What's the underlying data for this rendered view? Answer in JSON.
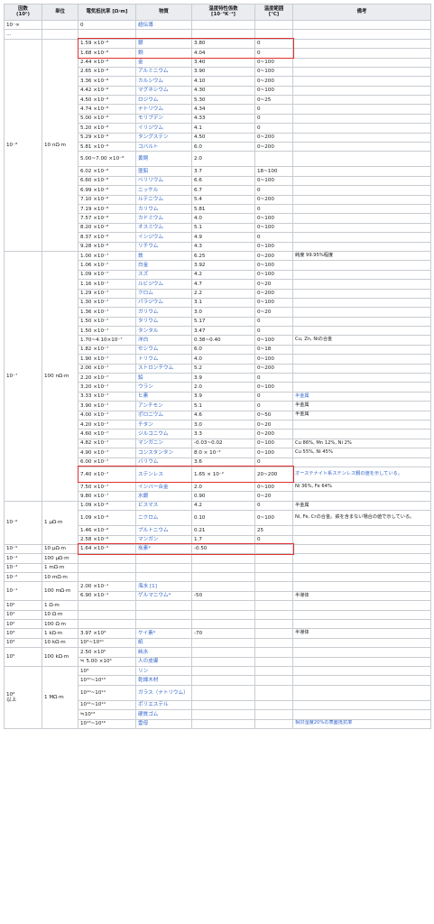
{
  "headers": {
    "factor": "因数\n(10ⁿ)",
    "unit": "単位",
    "resistivity": "電気抵抗率 [Ω·m]",
    "material": "物質",
    "tempcoef": "温度特性係数\n[10⁻³K⁻¹]",
    "temprange": "温度範囲\n[℃]",
    "note": "備考"
  },
  "top_rows": [
    {
      "factor": "10⁻∞",
      "resistivity": "0",
      "material": "超伝導",
      "link": true
    },
    {
      "factor": "…"
    }
  ],
  "groups": [
    {
      "factor": "10⁻⁸",
      "unit": "10 nΩ·m",
      "rows": [
        {
          "r": "1.59 ×10⁻⁸",
          "m": "銀",
          "c": "3.80",
          "t": "0",
          "hl": "silver"
        },
        {
          "r": "1.68 ×10⁻⁸",
          "m": "銅",
          "c": "4.04",
          "t": "0",
          "hl": "copper"
        },
        {
          "r": "2.44 ×10⁻⁸",
          "m": "金",
          "c": "3.40",
          "t": "0~100"
        },
        {
          "r": "2.65 ×10⁻⁸",
          "m": "アルミニウム",
          "c": "3.90",
          "t": "0~100"
        },
        {
          "r": "3.36 ×10⁻⁸",
          "m": "カルシウム",
          "c": "4.10",
          "t": "0~200"
        },
        {
          "r": "4.42 ×10⁻⁸",
          "m": "マグネシウム",
          "c": "4.30",
          "t": "0~100"
        },
        {
          "r": "4.50 ×10⁻⁸",
          "m": "ロジウム",
          "c": "5.30",
          "t": "0~25"
        },
        {
          "r": "4.74 ×10⁻⁸",
          "m": "ナトリウム",
          "c": "4.34",
          "t": "0"
        },
        {
          "r": "5.00 ×10⁻⁸",
          "m": "モリブデン",
          "c": "4.33",
          "t": "0"
        },
        {
          "r": "5.20 ×10⁻⁸",
          "m": "イリジウム",
          "c": "4.1",
          "t": "0"
        },
        {
          "r": "5.29 ×10⁻⁸",
          "m": "タングステン",
          "c": "4.50",
          "t": "0~200"
        },
        {
          "r": "5.81 ×10⁻⁸",
          "m": "コバルト",
          "c": "6.0",
          "t": "0~200"
        },
        {
          "r": "5.00~7.00 ×10⁻⁸",
          "m": "黄銅",
          "c": "2.0",
          "t": "",
          "tall": true
        },
        {
          "r": "6.02 ×10⁻⁸",
          "m": "亜鉛",
          "c": "3.7",
          "t": "18~100"
        },
        {
          "r": "6.60 ×10⁻⁸",
          "m": "ベリリウム",
          "c": "6.6",
          "t": "0~100"
        },
        {
          "r": "6.99 ×10⁻⁸",
          "m": "ニッケル",
          "c": "6.7",
          "t": "0"
        },
        {
          "r": "7.10 ×10⁻⁸",
          "m": "ルテニウム",
          "c": "5.4",
          "t": "0~200"
        },
        {
          "r": "7.19 ×10⁻⁸",
          "m": "カリウム",
          "c": "5.81",
          "t": "0"
        },
        {
          "r": "7.57 ×10⁻⁸",
          "m": "カドミウム",
          "c": "4.0",
          "t": "0~100"
        },
        {
          "r": "8.20 ×10⁻⁸",
          "m": "オスミウム",
          "c": "5.1",
          "t": "0~100"
        },
        {
          "r": "8.37 ×10⁻⁸",
          "m": "インジウム",
          "c": "4.9",
          "t": "0"
        },
        {
          "r": "9.28 ×10⁻⁸",
          "m": "リチウム",
          "c": "4.3",
          "t": "0~100"
        }
      ]
    },
    {
      "factor": "10⁻⁷",
      "unit": "100 nΩ·m",
      "rows": [
        {
          "r": "1.00 ×10⁻⁷",
          "m": "鉄",
          "c": "6.25",
          "t": "0~200",
          "n": "純度 99.95%程度"
        },
        {
          "r": "1.06 ×10⁻⁷",
          "m": "白金",
          "c": "3.92",
          "t": "0~100"
        },
        {
          "r": "1.09 ×10⁻⁷",
          "m": "スズ",
          "c": "4.2",
          "t": "0~100"
        },
        {
          "r": "1.16 ×10⁻⁷",
          "m": "ルビジウム",
          "c": "4.7",
          "t": "0~20"
        },
        {
          "r": "1.29 ×10⁻⁷",
          "m": "クロム",
          "c": "2.2",
          "t": "0~200"
        },
        {
          "r": "1.30 ×10⁻⁷",
          "m": "パラジウム",
          "c": "3.1",
          "t": "0~100"
        },
        {
          "r": "1.36 ×10⁻⁷",
          "m": "ガリウム",
          "c": "3.0",
          "t": "0~20"
        },
        {
          "r": "1.50 ×10⁻⁷",
          "m": "タリウム",
          "c": "5.17",
          "t": "0"
        },
        {
          "r": "1.50 ×10⁻⁷",
          "m": "タンタル",
          "c": "3.47",
          "t": "0"
        },
        {
          "r": "1.70~4.10×10⁻⁷",
          "m": "洋白",
          "c": "0.38~0.40",
          "t": "0~100",
          "n": "Cu, Zn, Niの合金"
        },
        {
          "r": "1.82 ×10⁻⁷",
          "m": "セシウム",
          "c": "6.0",
          "t": "0~18"
        },
        {
          "r": "1.90 ×10⁻⁷",
          "m": "トリウム",
          "c": "4.0",
          "t": "0~100"
        },
        {
          "r": "2.00 ×10⁻⁷",
          "m": "ストロンチウム",
          "c": "5.2",
          "t": "0~200"
        },
        {
          "r": "2.20 ×10⁻⁷",
          "m": "鉛",
          "c": "3.9",
          "t": "0"
        },
        {
          "r": "3.20 ×10⁻⁷",
          "m": "ウラン",
          "c": "2.0",
          "t": "0~100"
        },
        {
          "r": "3.33 ×10⁻⁷",
          "m": "ヒ素",
          "c": "3.9",
          "t": "0",
          "n": "半金属",
          "nlink": true
        },
        {
          "r": "3.90 ×10⁻⁷",
          "m": "アンチモン",
          "c": "5.1",
          "t": "0",
          "n": "半金属"
        },
        {
          "r": "4.00 ×10⁻⁷",
          "m": "ポロニウム",
          "c": "4.6",
          "t": "0~50",
          "n": "半金属"
        },
        {
          "r": "4.20 ×10⁻⁷",
          "m": "チタン",
          "c": "3.0",
          "t": "0~20"
        },
        {
          "r": "4.60 ×10⁻⁷",
          "m": "ジルコニウム",
          "c": "3.3",
          "t": "0~200"
        },
        {
          "r": "4.82 ×10⁻⁷",
          "m": "マンガニン",
          "c": "-0.03~0.02",
          "t": "0~100",
          "n": "Cu 86%, Mn 12%, Ni 2%"
        },
        {
          "r": "4.90 ×10⁻⁷",
          "m": "コンスタンタン",
          "c": "8.0 × 10⁻³",
          "t": "0~100",
          "n": "Cu 55%, Ni 45%"
        },
        {
          "r": "6.00 ×10⁻⁷",
          "m": "バリウム",
          "c": "3.6",
          "t": "0"
        },
        {
          "r": "7.40 ×10⁻⁷",
          "m": "ステンレス",
          "c": "1.65 × 10⁻²",
          "t": "20~200",
          "n": "オーステナイト系ステンレス鋼の値を示している。",
          "tall": true,
          "hl": "steel",
          "nlink": true
        },
        {
          "r": "7.50 ×10⁻⁷",
          "m": "インバー合金",
          "c": "2.0",
          "t": "0~100",
          "n": "Ni 36%, Fe 64%"
        },
        {
          "r": "9.80 ×10⁻⁷",
          "m": "水銀",
          "c": "0.90",
          "t": "0~20"
        }
      ]
    },
    {
      "factor": "10⁻⁶",
      "unit": "1 μΩ·m",
      "rows": [
        {
          "r": "1.09 ×10⁻⁶",
          "m": "ビスマス",
          "c": "4.2",
          "t": "0",
          "n": "半金属"
        },
        {
          "r": "1.09 ×10⁻⁶",
          "m": "ニクロム",
          "c": "0.10",
          "t": "0~100",
          "n": "Ni, Fe, Crの合金。鉄を含まない場合の値で示している。",
          "tall": true
        },
        {
          "r": "1.46 ×10⁻⁶",
          "m": "プルトニウム",
          "c": "0.21",
          "t": "25"
        },
        {
          "r": "2.58 ×10⁻⁶",
          "m": "マンガン",
          "c": "1.7",
          "t": "0"
        }
      ]
    },
    {
      "factor": "10⁻⁵",
      "unit": "10 μΩ·m",
      "rows": [
        {
          "r": "1.64 ×10⁻⁵",
          "m": "炭素*",
          "c": "-0.50",
          "t": "",
          "hl": "carbon"
        }
      ]
    },
    {
      "factor": "10⁻⁴",
      "unit": "100 μΩ·m",
      "rows": [
        {}
      ]
    },
    {
      "factor": "10⁻³",
      "unit": "1 mΩ·m",
      "rows": [
        {}
      ]
    },
    {
      "factor": "10⁻²",
      "unit": "10 mΩ·m",
      "rows": [
        {}
      ]
    },
    {
      "factor": "10⁻¹",
      "unit": "100 mΩ·m",
      "rows": [
        {
          "r": "2.00 ×10⁻¹",
          "m": "海水 [1]",
          "c": "",
          "t": ""
        },
        {
          "r": "6.90 ×10⁻¹",
          "m": "ゲルマニウム*",
          "c": "-50",
          "t": "",
          "n": "半導体"
        }
      ]
    },
    {
      "factor": "10⁰",
      "unit": "1 Ω·m",
      "rows": [
        {}
      ]
    },
    {
      "factor": "10¹",
      "unit": "10 Ω·m",
      "rows": [
        {}
      ]
    },
    {
      "factor": "10²",
      "unit": "100 Ω·m",
      "rows": [
        {}
      ]
    },
    {
      "factor": "10³",
      "unit": "1 kΩ·m",
      "rows": [
        {
          "r": "3.97 ×10³",
          "m": "ケイ素*",
          "c": "-70",
          "t": "",
          "n": "半導体"
        }
      ]
    },
    {
      "factor": "10⁴",
      "unit": "10 kΩ·m",
      "rows": [
        {
          "r": "10⁴~10¹⁰",
          "m": "紙",
          "c": "",
          "t": ""
        }
      ]
    },
    {
      "factor": "10⁵",
      "unit": "100 kΩ·m",
      "rows": [
        {
          "r": "2.50 ×10⁵",
          "m": "純水",
          "c": "",
          "t": ""
        },
        {
          "r": "≒ 5.00 ×10⁵",
          "m": "人の皮膚",
          "c": "",
          "t": ""
        }
      ]
    },
    {
      "factor": "10⁶\n以上",
      "unit": "1 MΩ·m",
      "rows": [
        {
          "r": "10⁹",
          "m": "リン",
          "c": "",
          "t": ""
        },
        {
          "r": "10¹⁰~10¹³",
          "m": "乾燥木材",
          "c": "",
          "t": ""
        },
        {
          "r": "10¹⁰~10¹⁴",
          "m": "ガラス（ナトリウム）",
          "c": "",
          "t": "",
          "tall": true
        },
        {
          "r": "10¹²~10¹⁴",
          "m": "ポリエステル",
          "c": "",
          "t": ""
        },
        {
          "r": "≒10¹³",
          "m": "硬質ゴム",
          "c": "",
          "t": "",
          "red": true
        },
        {
          "r": "10¹³~10¹⁶",
          "m": "雲母",
          "c": "",
          "t": "",
          "n": "相対湿度20%の表面抵抗率",
          "nlink": true
        }
      ]
    }
  ]
}
